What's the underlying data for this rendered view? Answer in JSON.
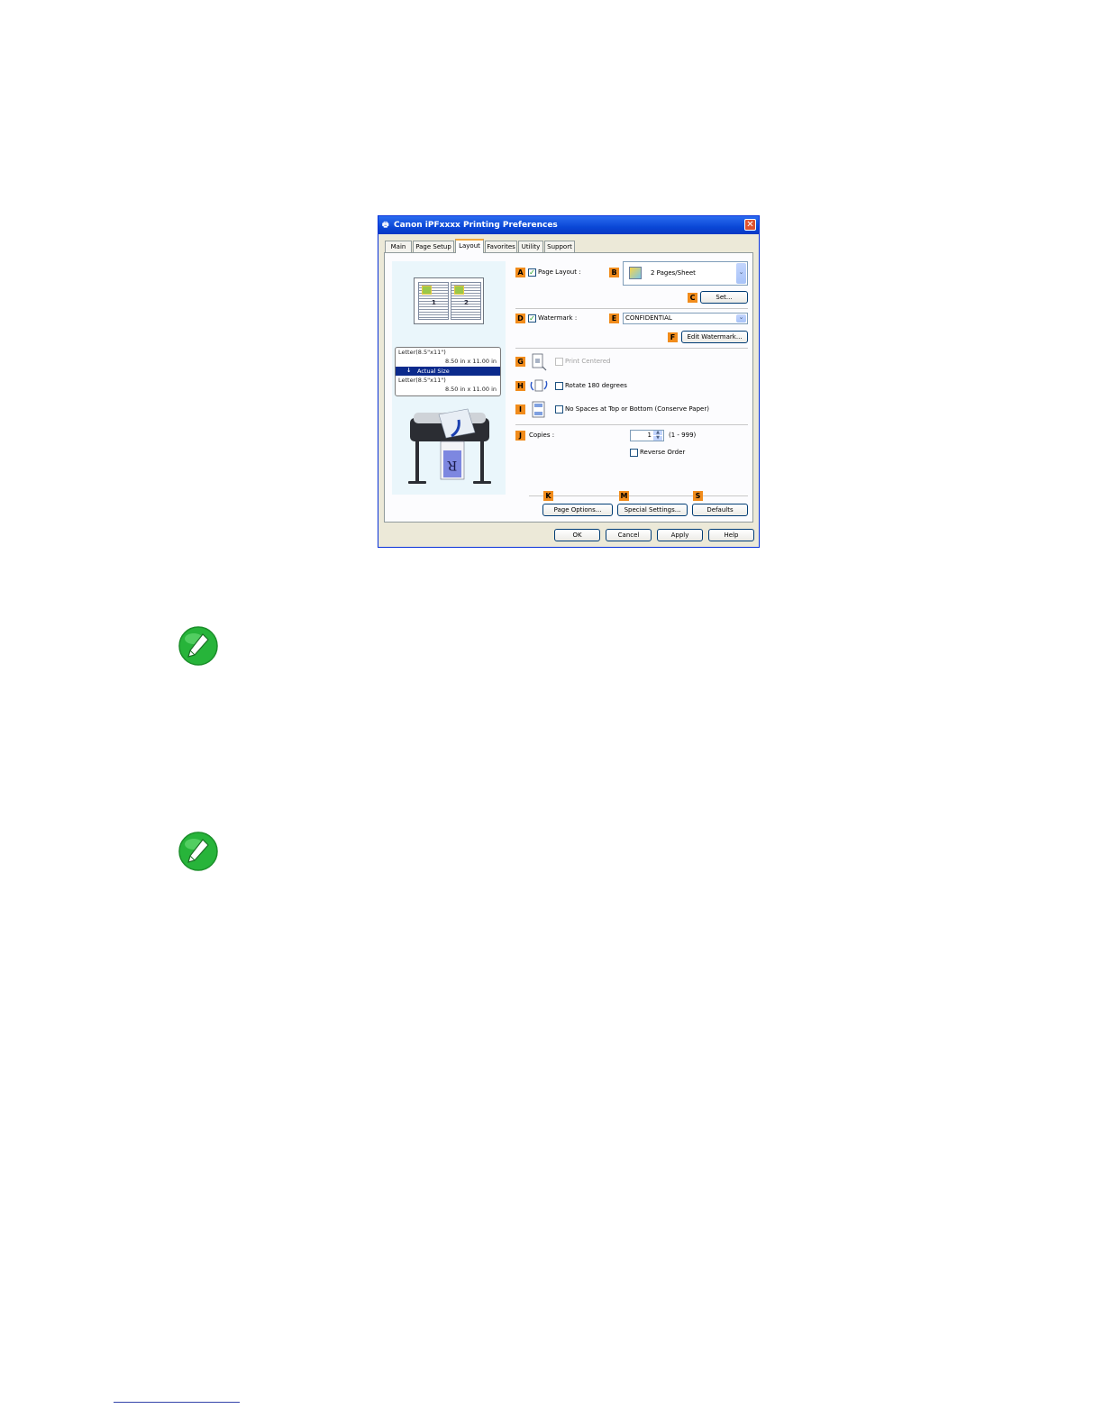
{
  "dialog": {
    "title": "Canon iPFxxxx Printing Preferences",
    "close_symbol": "✕",
    "tabs": [
      {
        "label": "Main"
      },
      {
        "label": "Page Setup"
      },
      {
        "label": "Layout"
      },
      {
        "label": "Favorites"
      },
      {
        "label": "Utility"
      },
      {
        "label": "Support"
      }
    ],
    "active_tab": "Layout",
    "preview": {
      "page_numbers": [
        "1",
        "2"
      ],
      "size_lines": [
        "Letter(8.5\"x11\")",
        "8.50 in x 11.00 in",
        "Actual Size",
        "Letter(8.5\"x11\")",
        "8.50 in x 11.00 in"
      ],
      "arrow_symbol": "↓",
      "print_glyph": "R"
    },
    "labels": {
      "A": "A",
      "B": "B",
      "C": "C",
      "D": "D",
      "E": "E",
      "F": "F",
      "G": "G",
      "H": "H",
      "I": "I",
      "J": "J",
      "K": "K",
      "M": "M",
      "S": "S"
    },
    "page_layout": {
      "label": "Page Layout :",
      "checked": true,
      "check_symbol": "✓",
      "value": "2 Pages/Sheet"
    },
    "set_button": "Set...",
    "watermark": {
      "label": "Watermark :",
      "checked": true,
      "check_symbol": "✓",
      "value": "CONFIDENTIAL"
    },
    "edit_watermark_button": "Edit Watermark...",
    "print_centered": {
      "label": "Print Centered",
      "checked": false,
      "enabled": false
    },
    "rotate": {
      "label": "Rotate 180 degrees",
      "checked": false
    },
    "no_spaces": {
      "label": "No Spaces at Top or Bottom (Conserve Paper)",
      "checked": false
    },
    "copies": {
      "label": "Copies :",
      "value": "1",
      "range": "(1 - 999)"
    },
    "reverse_order": {
      "label": "Reverse Order",
      "checked": false
    },
    "spinner_up": "▲",
    "spinner_down": "▼",
    "dropdown_arrow": "⌄",
    "buttons": {
      "page_options": "Page Options...",
      "special_settings": "Special Settings...",
      "defaults": "Defaults",
      "ok": "OK",
      "cancel": "Cancel",
      "apply": "Apply",
      "help": "Help"
    }
  },
  "colors": {
    "title_bar": "#0a47d6",
    "label_badge": "#f18c1c",
    "note_icon": "#27b43a"
  }
}
